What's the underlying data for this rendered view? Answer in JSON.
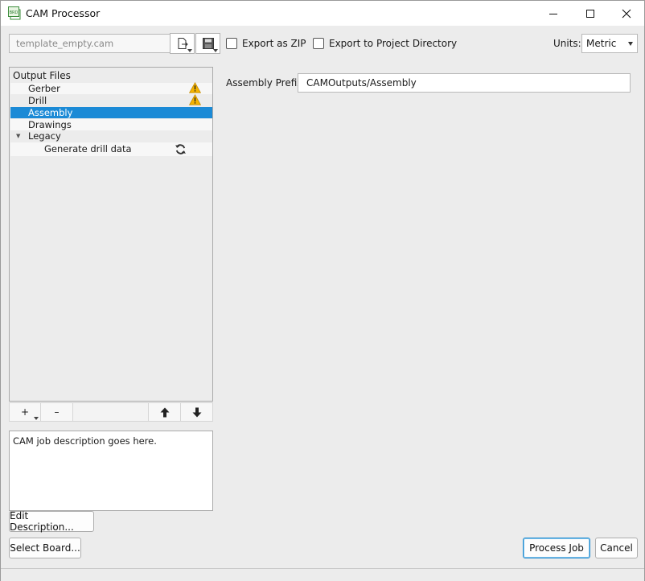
{
  "window": {
    "title": "CAM Processor",
    "app_icon_text": "BRD"
  },
  "toolbar": {
    "file_field_value": "template_empty.cam",
    "export_zip_label": "Export as ZIP",
    "export_project_label": "Export to Project Directory",
    "units_label": "Units:",
    "units_value": "Metric"
  },
  "tree": {
    "header": "Output Files",
    "items": [
      {
        "label": "Gerber",
        "icon": "warning-icon"
      },
      {
        "label": "Drill",
        "icon": "warning-icon"
      },
      {
        "label": "Assembly",
        "selected": true
      },
      {
        "label": "Drawings"
      },
      {
        "label": "Legacy",
        "expanded": true
      },
      {
        "label": "Generate drill data",
        "icon": "refresh-icon",
        "child": true
      }
    ],
    "buttons": {
      "add": "+",
      "remove": "–"
    }
  },
  "description": {
    "text": "CAM job description goes here.",
    "edit_button": "Edit Description..."
  },
  "details": {
    "prefix_label": "Assembly Prefix",
    "prefix_value": "CAMOutputs/Assembly"
  },
  "footer": {
    "select_board": "Select Board...",
    "process_job": "Process Job",
    "cancel": "Cancel"
  },
  "colors": {
    "selection": "#1b8ad6",
    "warning": "#f5b400",
    "primary_border": "#2a8fd0"
  }
}
